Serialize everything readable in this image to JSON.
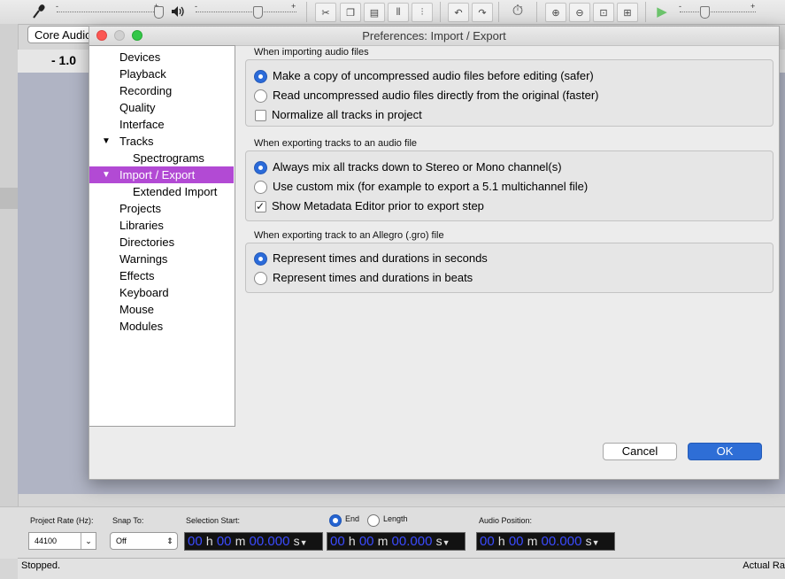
{
  "toolbar": {
    "mic_icon": "microphone-icon",
    "speaker_icon": "speaker-icon",
    "plus": "+",
    "minus": "-",
    "icons": [
      "cut-icon",
      "copy-icon",
      "paste-icon",
      "trim-icon",
      "silence-icon",
      "undo-icon",
      "redo-icon",
      "sync-lock-icon",
      "zoom-in-icon",
      "zoom-out-icon",
      "fit-selection-icon",
      "fit-project-icon",
      "play-at-speed-icon"
    ]
  },
  "host": {
    "value": "Core Audio"
  },
  "timeline": {
    "label": "- 1.0"
  },
  "dialog": {
    "title": "Preferences: Import / Export",
    "tree": [
      {
        "label": "Devices",
        "indent": 0,
        "arrow": "",
        "selected": false
      },
      {
        "label": "Playback",
        "indent": 0,
        "arrow": "",
        "selected": false
      },
      {
        "label": "Recording",
        "indent": 0,
        "arrow": "",
        "selected": false
      },
      {
        "label": "Quality",
        "indent": 0,
        "arrow": "",
        "selected": false
      },
      {
        "label": "Interface",
        "indent": 0,
        "arrow": "",
        "selected": false
      },
      {
        "label": "Tracks",
        "indent": 0,
        "arrow": "▼",
        "selected": false
      },
      {
        "label": "Spectrograms",
        "indent": 1,
        "arrow": "",
        "selected": false
      },
      {
        "label": "Import / Export",
        "indent": 0,
        "arrow": "▼",
        "selected": true
      },
      {
        "label": "Extended Import",
        "indent": 1,
        "arrow": "",
        "selected": false
      },
      {
        "label": "Projects",
        "indent": 0,
        "arrow": "",
        "selected": false
      },
      {
        "label": "Libraries",
        "indent": 0,
        "arrow": "",
        "selected": false
      },
      {
        "label": "Directories",
        "indent": 0,
        "arrow": "",
        "selected": false
      },
      {
        "label": "Warnings",
        "indent": 0,
        "arrow": "",
        "selected": false
      },
      {
        "label": "Effects",
        "indent": 0,
        "arrow": "",
        "selected": false
      },
      {
        "label": "Keyboard",
        "indent": 0,
        "arrow": "",
        "selected": false
      },
      {
        "label": "Mouse",
        "indent": 0,
        "arrow": "",
        "selected": false
      },
      {
        "label": "Modules",
        "indent": 0,
        "arrow": "",
        "selected": false
      }
    ],
    "groups": {
      "import": {
        "title": "When importing audio files",
        "copy_label": "Make a copy of uncompressed audio files before editing (safer)",
        "read_label": "Read uncompressed audio files directly from the original (faster)",
        "normalize_label": "Normalize all tracks in project"
      },
      "export": {
        "title": "When exporting tracks to an audio file",
        "mix_label": "Always mix all tracks down to Stereo or Mono channel(s)",
        "custom_label": "Use custom mix (for example to export a 5.1 multichannel file)",
        "metadata_label": "Show Metadata Editor prior to export step"
      },
      "allegro": {
        "title": "When exporting track to an Allegro (.gro) file",
        "seconds_label": "Represent times and durations in seconds",
        "beats_label": "Represent times and durations in beats"
      }
    },
    "buttons": {
      "cancel": "Cancel",
      "ok": "OK"
    }
  },
  "selection_bar": {
    "project_rate_label": "Project Rate (Hz):",
    "project_rate_value": "44100",
    "snap_label": "Snap To:",
    "snap_value": "Off",
    "selection_start_label": "Selection Start:",
    "end_label": "End",
    "length_label": "Length",
    "audio_position_label": "Audio Position:",
    "time_hh": "00",
    "time_mm": "00",
    "time_ss": "00.000",
    "unit_h": "h",
    "unit_m": "m",
    "unit_s": "s"
  },
  "status": {
    "left": "Stopped.",
    "right": "Actual Ra"
  },
  "colors": {
    "accent_blue": "#2e6ed6",
    "tree_selected": "#b24ad4",
    "time_digits": "#3b4bff"
  }
}
